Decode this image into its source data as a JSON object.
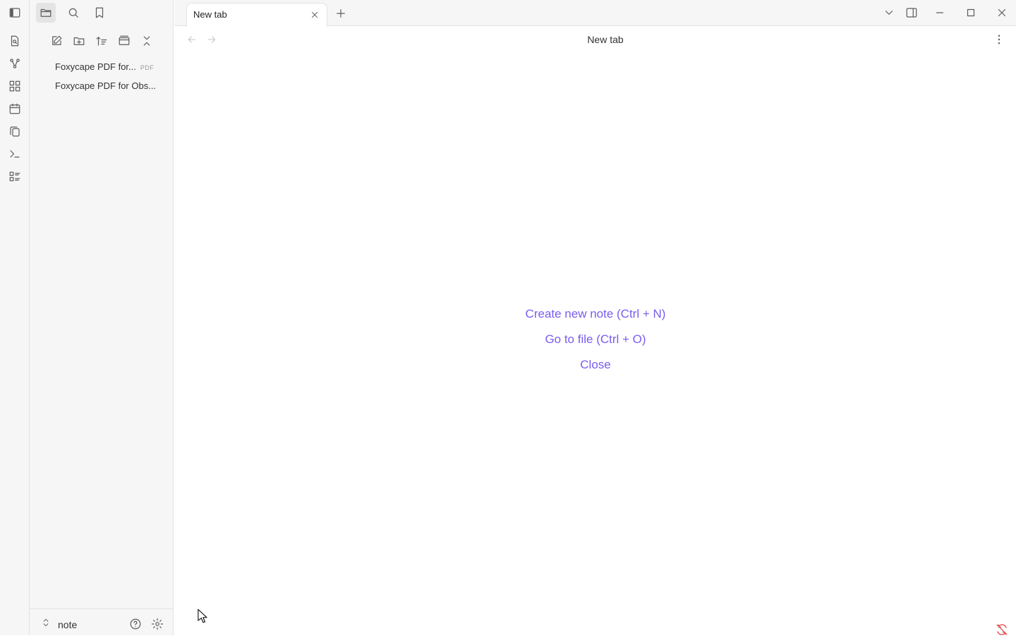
{
  "tabs": [
    {
      "label": "New tab"
    }
  ],
  "view": {
    "title": "New tab"
  },
  "files": [
    {
      "name": "Foxycape PDF for...",
      "badge": "PDF"
    },
    {
      "name": "Foxycape PDF for Obs..."
    }
  ],
  "empty_state": {
    "create": "Create new note (Ctrl + N)",
    "goto": "Go to file (Ctrl + O)",
    "close": "Close"
  },
  "vault": {
    "name": "note"
  },
  "colors": {
    "accent": "#7a5cf0",
    "sidebar_bg": "#f6f6f6",
    "sync_warning": "#e05050"
  },
  "icons": {
    "ribbon": [
      "file-icon",
      "graph-icon",
      "canvas-icon",
      "calendar-icon",
      "copy-icon",
      "terminal-icon",
      "command-list-icon"
    ],
    "sidebar_tabs": [
      "folder-icon",
      "search-icon",
      "bookmark-icon"
    ],
    "file_actions": [
      "new-note-icon",
      "new-folder-icon",
      "sort-icon",
      "auto-reveal-icon",
      "collapse-all-icon"
    ]
  }
}
